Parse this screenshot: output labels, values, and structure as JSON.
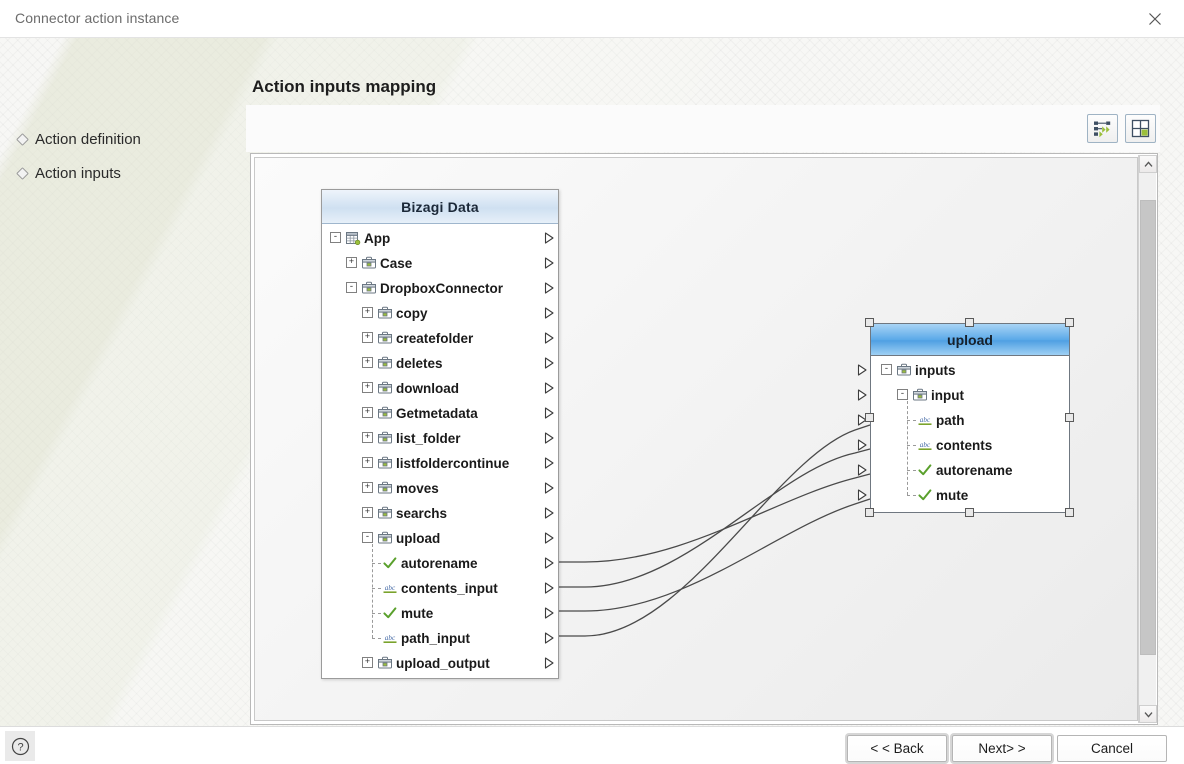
{
  "window": {
    "title": "Connector action instance",
    "close_icon": "close-icon"
  },
  "sidebar": {
    "items": [
      {
        "label": "Action definition",
        "icon": "diamond-bullet-icon"
      },
      {
        "label": "Action inputs",
        "icon": "diamond-bullet-icon"
      }
    ]
  },
  "main": {
    "page_title": "Action inputs mapping",
    "toolbar": [
      {
        "name": "auto-map-button",
        "icon": "auto-map-icon",
        "title": "Auto map"
      },
      {
        "name": "fit-layout-button",
        "icon": "fit-layout-icon",
        "title": "Arrange"
      }
    ]
  },
  "tree": {
    "header": "Bizagi Data",
    "rows": [
      {
        "label": "App",
        "depth": 0,
        "expander": "-",
        "icon": "table-icon",
        "port": true
      },
      {
        "label": "Case",
        "depth": 1,
        "expander": "+",
        "icon": "briefcase-icon",
        "port": true
      },
      {
        "label": "DropboxConnector",
        "depth": 1,
        "expander": "-",
        "icon": "briefcase-icon",
        "port": true
      },
      {
        "label": "copy",
        "depth": 2,
        "expander": "+",
        "icon": "briefcase-icon",
        "port": true
      },
      {
        "label": "createfolder",
        "depth": 2,
        "expander": "+",
        "icon": "briefcase-icon",
        "port": true
      },
      {
        "label": "deletes",
        "depth": 2,
        "expander": "+",
        "icon": "briefcase-icon",
        "port": true
      },
      {
        "label": "download",
        "depth": 2,
        "expander": "+",
        "icon": "briefcase-icon",
        "port": true
      },
      {
        "label": "Getmetadata",
        "depth": 2,
        "expander": "+",
        "icon": "briefcase-icon",
        "port": true
      },
      {
        "label": "list_folder",
        "depth": 2,
        "expander": "+",
        "icon": "briefcase-icon",
        "port": true
      },
      {
        "label": "listfoldercontinue",
        "depth": 2,
        "expander": "+",
        "icon": "briefcase-icon",
        "port": true
      },
      {
        "label": "moves",
        "depth": 2,
        "expander": "+",
        "icon": "briefcase-icon",
        "port": true
      },
      {
        "label": "searchs",
        "depth": 2,
        "expander": "+",
        "icon": "briefcase-icon",
        "port": true
      },
      {
        "label": "upload",
        "depth": 2,
        "expander": "-",
        "icon": "briefcase-icon",
        "port": true
      },
      {
        "label": "autorename",
        "depth": 3,
        "expander": "",
        "icon": "boolean-check-icon",
        "port": true
      },
      {
        "label": "contents_input",
        "depth": 3,
        "expander": "",
        "icon": "abc-string-icon",
        "port": true
      },
      {
        "label": "mute",
        "depth": 3,
        "expander": "",
        "icon": "boolean-check-icon",
        "port": true
      },
      {
        "label": "path_input",
        "depth": 3,
        "expander": "",
        "icon": "abc-string-icon",
        "port": true
      },
      {
        "label": "upload_output",
        "depth": 2,
        "expander": "+",
        "icon": "briefcase-icon",
        "port": true
      }
    ]
  },
  "node": {
    "title": "upload",
    "selected": true,
    "rows": [
      {
        "label": "inputs",
        "depth": 0,
        "expander": "-",
        "icon": "briefcase-icon",
        "port": true
      },
      {
        "label": "input",
        "depth": 1,
        "expander": "-",
        "icon": "briefcase-icon",
        "port": true
      },
      {
        "label": "path",
        "depth": 2,
        "expander": "",
        "icon": "abc-string-icon",
        "port": true
      },
      {
        "label": "contents",
        "depth": 2,
        "expander": "",
        "icon": "abc-string-icon",
        "port": true
      },
      {
        "label": "autorename",
        "depth": 2,
        "expander": "",
        "icon": "boolean-check-icon",
        "port": true
      },
      {
        "label": "mute",
        "depth": 2,
        "expander": "",
        "icon": "boolean-check-icon",
        "port": true
      }
    ]
  },
  "mappings": [
    {
      "from": "path_input",
      "to": "path"
    },
    {
      "from": "contents_input",
      "to": "contents"
    },
    {
      "from": "autorename",
      "to": "autorename"
    },
    {
      "from": "mute",
      "to": "mute"
    }
  ],
  "scrollbar": {
    "up_icon": "chevron-up-icon",
    "down_icon": "chevron-down-icon"
  },
  "footer": {
    "help_icon": "help-circle-icon",
    "back_label": "< < Back",
    "next_label": "Next> >",
    "cancel_label": "Cancel"
  },
  "colors": {
    "tree_header": "#cfe0f1",
    "node_header": "#59a8e8",
    "string_icon": "#6f9e1f",
    "bool_icon": "#5aa02c",
    "link": "#4a4a4a"
  }
}
